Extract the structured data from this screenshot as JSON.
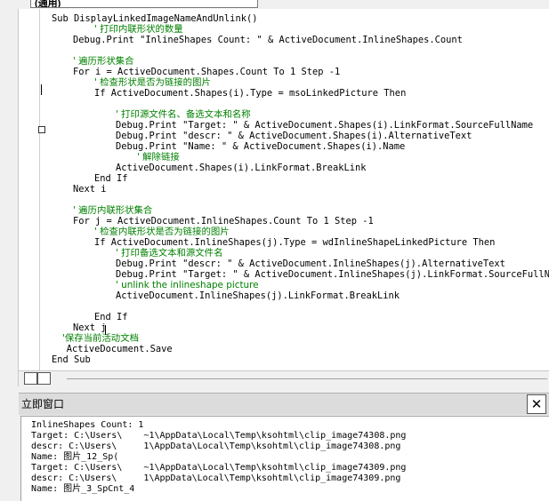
{
  "procedure_combo": "(通用)",
  "code_lines": [
    {
      "indent": 0,
      "text": "Sub DisplayLinkedImageNameAndUnlink()",
      "kind": "code"
    },
    {
      "indent": 2,
      "text": "' 打印内联形状的数量",
      "kind": "comment"
    },
    {
      "indent": 1,
      "text": "Debug.Print \"InlineShapes Count: \" & ActiveDocument.InlineShapes.Count",
      "kind": "code"
    },
    {
      "indent": 0,
      "text": "",
      "kind": "blank"
    },
    {
      "indent": 1,
      "text": "' 遍历形状集合",
      "kind": "comment"
    },
    {
      "indent": 1,
      "text": "For i = ActiveDocument.Shapes.Count To 1 Step -1",
      "kind": "code"
    },
    {
      "indent": 2,
      "text": "' 检查形状是否为链接的图片",
      "kind": "comment"
    },
    {
      "indent": 2,
      "text": "If ActiveDocument.Shapes(i).Type = msoLinkedPicture Then",
      "kind": "code"
    },
    {
      "indent": 0,
      "text": "",
      "kind": "blank"
    },
    {
      "indent": 3,
      "text": "' 打印源文件名、备选文本和名称",
      "kind": "comment"
    },
    {
      "indent": 3,
      "text": "Debug.Print \"Target: \" & ActiveDocument.Shapes(i).LinkFormat.SourceFullName",
      "kind": "code"
    },
    {
      "indent": 3,
      "text": "Debug.Print \"descr: \" & ActiveDocument.Shapes(i).AlternativeText",
      "kind": "code"
    },
    {
      "indent": 3,
      "text": "Debug.Print \"Name: \" & ActiveDocument.Shapes(i).Name",
      "kind": "code"
    },
    {
      "indent": 4,
      "text": "' 解除链接",
      "kind": "comment"
    },
    {
      "indent": 3,
      "text": "ActiveDocument.Shapes(i).LinkFormat.BreakLink",
      "kind": "code"
    },
    {
      "indent": 2,
      "text": "End If",
      "kind": "code"
    },
    {
      "indent": 1,
      "text": "Next i",
      "kind": "code"
    },
    {
      "indent": 0,
      "text": "",
      "kind": "blank"
    },
    {
      "indent": 1,
      "text": "' 遍历内联形状集合",
      "kind": "comment"
    },
    {
      "indent": 1,
      "text": "For j = ActiveDocument.InlineShapes.Count To 1 Step -1",
      "kind": "code"
    },
    {
      "indent": 2,
      "text": "' 检查内联形状是否为链接的图片",
      "kind": "comment"
    },
    {
      "indent": 2,
      "text": "If ActiveDocument.InlineShapes(j).Type = wdInlineShapeLinkedPicture Then",
      "kind": "code"
    },
    {
      "indent": 3,
      "text": "' 打印备选文本和源文件名",
      "kind": "comment"
    },
    {
      "indent": 3,
      "text": "Debug.Print \"descr: \" & ActiveDocument.InlineShapes(j).AlternativeText",
      "kind": "code"
    },
    {
      "indent": 3,
      "text": "Debug.Print \"Target: \" & ActiveDocument.InlineShapes(j).LinkFormat.SourceFullName",
      "kind": "code"
    },
    {
      "indent": 3,
      "text": "' unlink the inlineshape picture",
      "kind": "comment"
    },
    {
      "indent": 3,
      "text": "ActiveDocument.InlineShapes(j).LinkFormat.BreakLink",
      "kind": "code"
    },
    {
      "indent": 0,
      "text": "",
      "kind": "blank"
    },
    {
      "indent": 2,
      "text": "End If",
      "kind": "code"
    },
    {
      "indent": 1,
      "text": "Next j",
      "kind": "code"
    },
    {
      "indent": 0.5,
      "text": "'保存当前活动文档",
      "kind": "comment"
    },
    {
      "indent": 0.7,
      "text": "ActiveDocument.Save",
      "kind": "code"
    },
    {
      "indent": 0,
      "text": "End Sub",
      "kind": "code"
    }
  ],
  "immediate_window": {
    "title": "立即窗口",
    "close_label": "✕",
    "lines": [
      "InlineShapes Count: 1",
      "Target: C:\\Users\\    ~1\\AppData\\Local\\Temp\\ksohtml\\clip_image74308.png",
      "descr: C:\\Users\\     1\\AppData\\Local\\Temp\\ksohtml\\clip_image74308.png",
      "Name: 图片_12_Sp(",
      "Target: C:\\Users\\    ~1\\AppData\\Local\\Temp\\ksohtml\\clip_image74309.png",
      "descr: C:\\Users\\     1\\AppData\\Local\\Temp\\ksohtml\\clip_image74309.png",
      "Name: 图片_3_SpCnt_4"
    ]
  },
  "colors": {
    "keyword": "#00007f",
    "comment": "#008000"
  }
}
